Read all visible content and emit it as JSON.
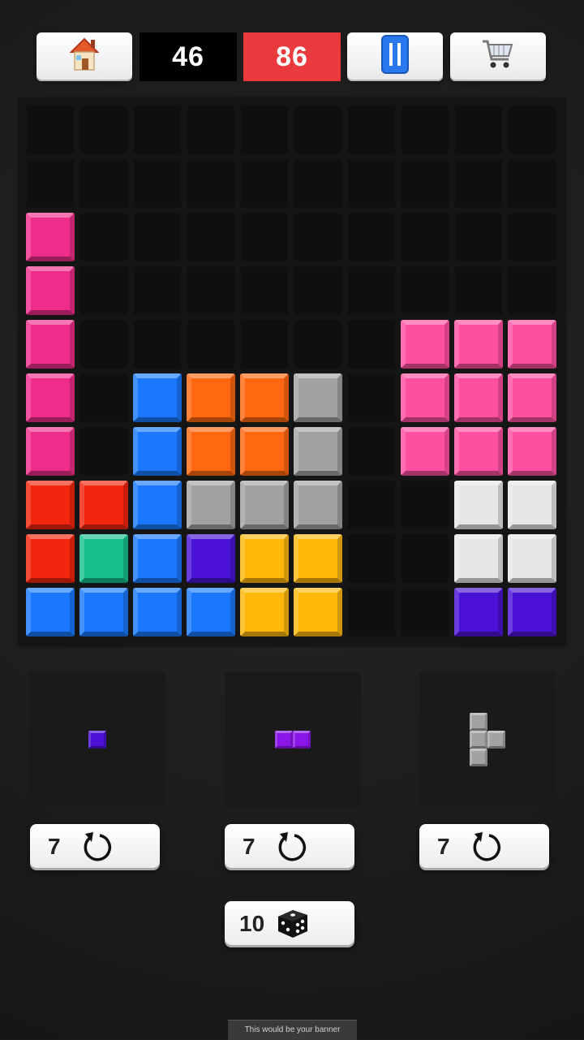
{
  "colors": {
    "pink": "#ff4fa0",
    "magenta": "#ee2d8a",
    "red": "#f2250e",
    "blue": "#1a78ff",
    "orange": "#ff6810",
    "gray": "#a2a2a2",
    "teal": "#17c08d",
    "indigo": "#4a12d6",
    "yellow": "#ffb80a",
    "white": "#e6e6e6",
    "violet": "#8a16e8",
    "score_bg": "#000000",
    "best_bg": "#ea3a3e"
  },
  "topbar": {
    "home_icon": "home-icon",
    "score": "46",
    "best": "86",
    "pause_icon": "pause-icon",
    "shop_icon": "cart-icon"
  },
  "board": {
    "size": 10,
    "cells": [
      {
        "row": 2,
        "col": 0,
        "color": "magenta"
      },
      {
        "row": 3,
        "col": 0,
        "color": "magenta"
      },
      {
        "row": 4,
        "col": 0,
        "color": "magenta"
      },
      {
        "row": 5,
        "col": 0,
        "color": "magenta"
      },
      {
        "row": 6,
        "col": 0,
        "color": "magenta"
      },
      {
        "row": 7,
        "col": 0,
        "color": "red"
      },
      {
        "row": 8,
        "col": 0,
        "color": "red"
      },
      {
        "row": 9,
        "col": 0,
        "color": "blue"
      },
      {
        "row": 7,
        "col": 1,
        "color": "red"
      },
      {
        "row": 8,
        "col": 1,
        "color": "teal"
      },
      {
        "row": 9,
        "col": 1,
        "color": "blue"
      },
      {
        "row": 5,
        "col": 2,
        "color": "blue"
      },
      {
        "row": 6,
        "col": 2,
        "color": "blue"
      },
      {
        "row": 7,
        "col": 2,
        "color": "blue"
      },
      {
        "row": 8,
        "col": 2,
        "color": "blue"
      },
      {
        "row": 9,
        "col": 2,
        "color": "blue"
      },
      {
        "row": 5,
        "col": 3,
        "color": "orange"
      },
      {
        "row": 6,
        "col": 3,
        "color": "orange"
      },
      {
        "row": 7,
        "col": 3,
        "color": "gray"
      },
      {
        "row": 8,
        "col": 3,
        "color": "indigo"
      },
      {
        "row": 9,
        "col": 3,
        "color": "blue"
      },
      {
        "row": 5,
        "col": 4,
        "color": "orange"
      },
      {
        "row": 6,
        "col": 4,
        "color": "orange"
      },
      {
        "row": 7,
        "col": 4,
        "color": "gray"
      },
      {
        "row": 8,
        "col": 4,
        "color": "yellow"
      },
      {
        "row": 9,
        "col": 4,
        "color": "yellow"
      },
      {
        "row": 5,
        "col": 5,
        "color": "gray"
      },
      {
        "row": 6,
        "col": 5,
        "color": "gray"
      },
      {
        "row": 7,
        "col": 5,
        "color": "gray"
      },
      {
        "row": 8,
        "col": 5,
        "color": "yellow"
      },
      {
        "row": 9,
        "col": 5,
        "color": "yellow"
      },
      {
        "row": 4,
        "col": 7,
        "color": "pink"
      },
      {
        "row": 5,
        "col": 7,
        "color": "pink"
      },
      {
        "row": 6,
        "col": 7,
        "color": "pink"
      },
      {
        "row": 4,
        "col": 8,
        "color": "pink"
      },
      {
        "row": 5,
        "col": 8,
        "color": "pink"
      },
      {
        "row": 6,
        "col": 8,
        "color": "pink"
      },
      {
        "row": 7,
        "col": 8,
        "color": "white"
      },
      {
        "row": 8,
        "col": 8,
        "color": "white"
      },
      {
        "row": 9,
        "col": 8,
        "color": "indigo"
      },
      {
        "row": 4,
        "col": 9,
        "color": "pink"
      },
      {
        "row": 5,
        "col": 9,
        "color": "pink"
      },
      {
        "row": 6,
        "col": 9,
        "color": "pink"
      },
      {
        "row": 7,
        "col": 9,
        "color": "white"
      },
      {
        "row": 8,
        "col": 9,
        "color": "white"
      },
      {
        "row": 9,
        "col": 9,
        "color": "indigo"
      }
    ]
  },
  "pieces": [
    {
      "name": "single",
      "color": "indigo",
      "cells": [
        [
          0,
          0
        ]
      ]
    },
    {
      "name": "domino",
      "color": "violet",
      "cells": [
        [
          0,
          0
        ],
        [
          0,
          1
        ]
      ]
    },
    {
      "name": "tee",
      "color": "gray",
      "cells": [
        [
          0,
          0
        ],
        [
          1,
          0
        ],
        [
          2,
          0
        ],
        [
          1,
          1
        ]
      ]
    }
  ],
  "rotate_buttons": [
    {
      "count": "7",
      "icon": "rotate-icon"
    },
    {
      "count": "7",
      "icon": "rotate-icon"
    },
    {
      "count": "7",
      "icon": "rotate-icon"
    }
  ],
  "dice_button": {
    "count": "10",
    "icon": "dice-icon"
  },
  "banner": {
    "text": "This would be your banner"
  }
}
